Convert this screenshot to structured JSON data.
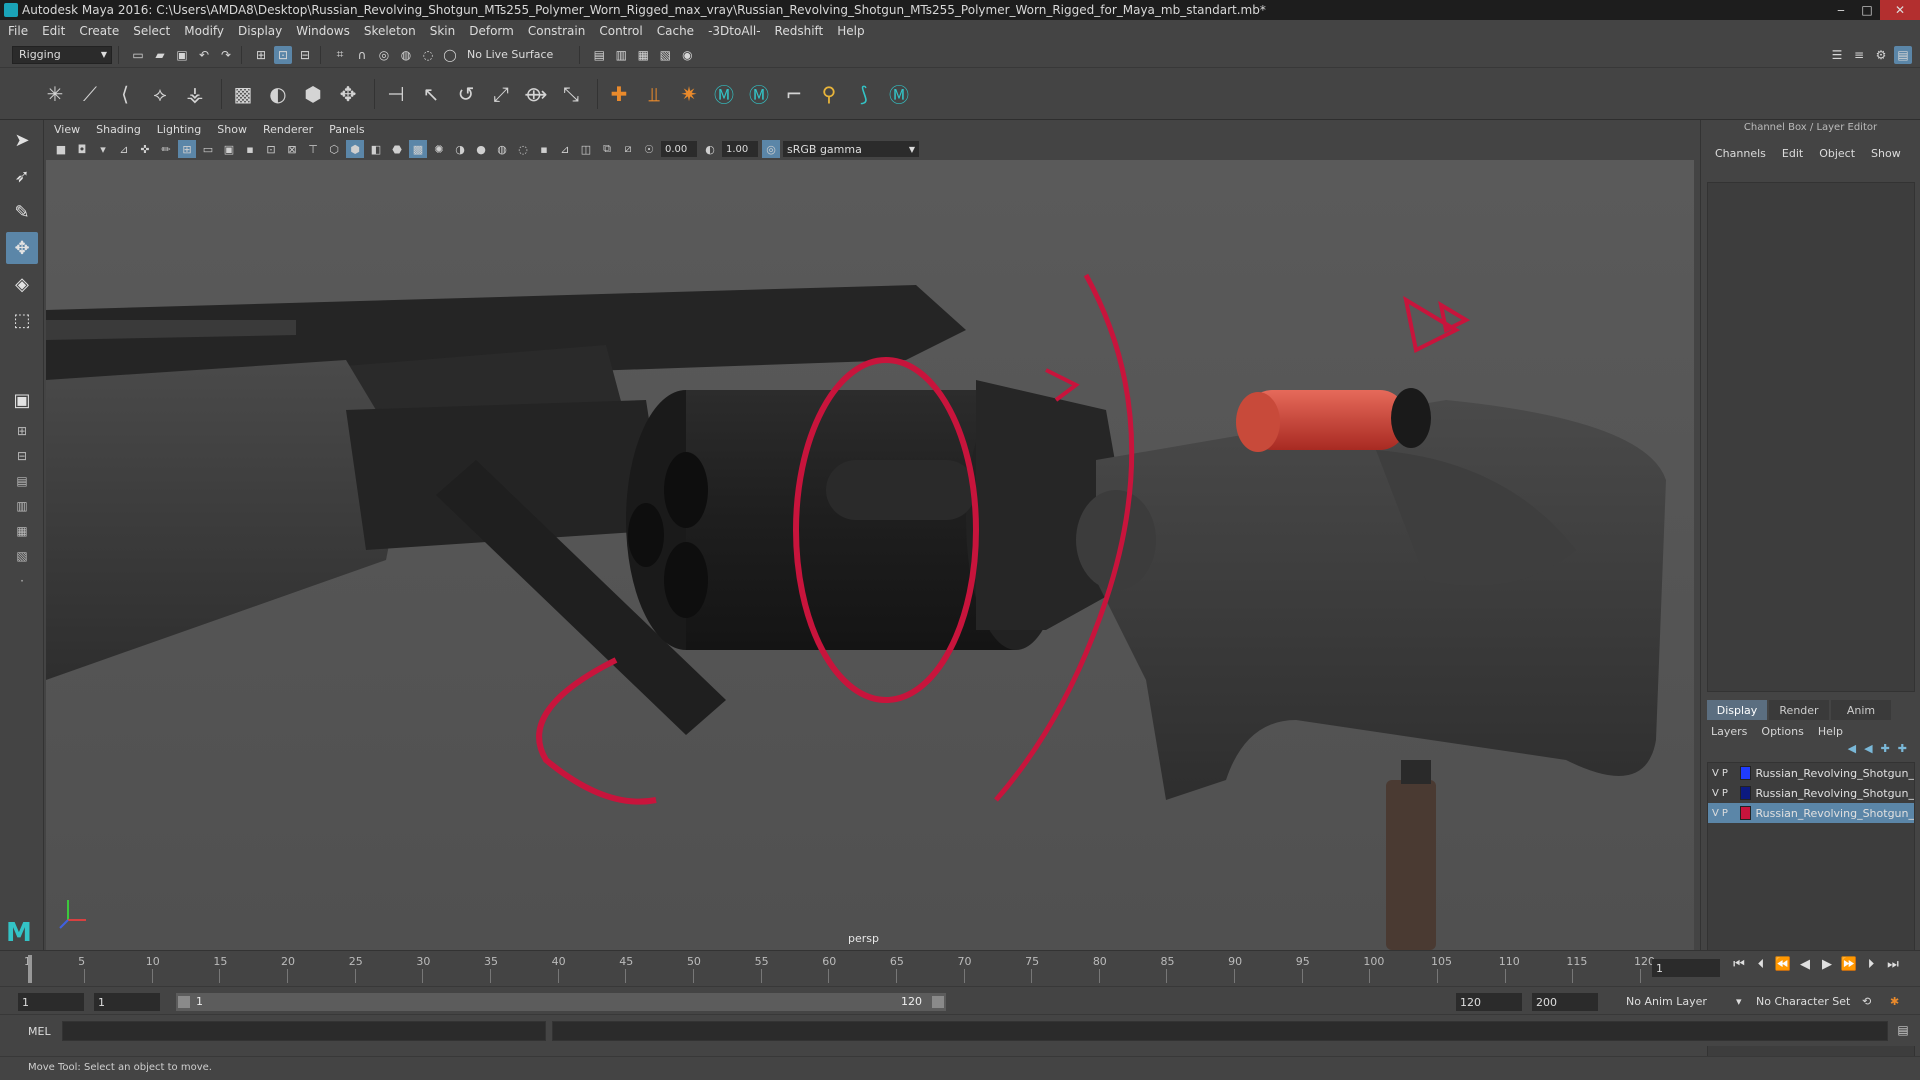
{
  "window": {
    "title": "Autodesk Maya 2016: C:\\Users\\AMDA8\\Desktop\\Russian_Revolving_Shotgun_MTs255_Polymer_Worn_Rigged_max_vray\\Russian_Revolving_Shotgun_MTs255_Polymer_Worn_Rigged_for_Maya_mb_standart.mb*",
    "minimize": "‒",
    "maximize": "□",
    "close": "✕"
  },
  "menubar": [
    "File",
    "Edit",
    "Create",
    "Select",
    "Modify",
    "Display",
    "Windows",
    "Skeleton",
    "Skin",
    "Deform",
    "Constrain",
    "Control",
    "Cache",
    "-3DtoAll-",
    "Redshift",
    "Help"
  ],
  "statusline": {
    "mode": "Rigging",
    "live_surface": "No Live Surface"
  },
  "panel": {
    "menu": [
      "View",
      "Shading",
      "Lighting",
      "Show",
      "Renderer",
      "Panels"
    ],
    "exposure": "0.00",
    "gamma_value": "1.00",
    "color_space": "sRGB gamma",
    "camera_label": "persp"
  },
  "channel_box": {
    "title": "Channel Box / Layer Editor",
    "menu": [
      "Channels",
      "Edit",
      "Object",
      "Show"
    ],
    "layer_tabs": [
      "Display",
      "Render",
      "Anim"
    ],
    "active_tab": "Display",
    "layer_menu": [
      "Layers",
      "Options",
      "Help"
    ],
    "layers": [
      {
        "v": "V",
        "p": "P",
        "color": "#1f3cff",
        "name": "Russian_Revolving_Shotgun_",
        "selected": false
      },
      {
        "v": "V",
        "p": "P",
        "color": "#0c1a80",
        "name": "Russian_Revolving_Shotgun_",
        "selected": false
      },
      {
        "v": "V",
        "p": "P",
        "color": "#c8143c",
        "name": "Russian_Revolving_Shotgun_",
        "selected": true
      }
    ]
  },
  "timeline": {
    "ticks": [
      "1",
      "5",
      "10",
      "15",
      "20",
      "25",
      "30",
      "35",
      "40",
      "45",
      "50",
      "55",
      "60",
      "65",
      "70",
      "75",
      "80",
      "85",
      "90",
      "95",
      "100",
      "105",
      "110",
      "115",
      "120"
    ],
    "min": 1,
    "max": 120,
    "current_frame": "1"
  },
  "range": {
    "start": "1",
    "playback_start": "1",
    "slider_left": "1",
    "slider_right": "120",
    "playback_end": "120",
    "end": "200",
    "anim_layer": "No Anim Layer",
    "character_set": "No Character Set"
  },
  "cmdline": {
    "label": "MEL"
  },
  "helpline": {
    "text": "Move Tool: Select an object to move."
  },
  "colors": {
    "control_curve": "#c8143c",
    "shell": "#d8463c",
    "selection": "#5b86a8"
  }
}
